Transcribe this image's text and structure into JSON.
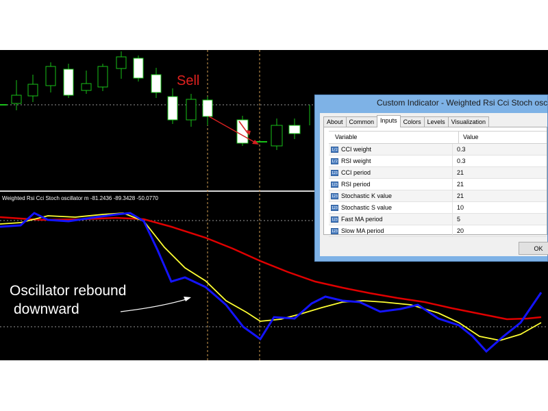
{
  "chart": {
    "sell_label": "Sell",
    "oscillator_header": "Weighted Rsi Cci Stoch oscillator m -81.2436 -89.3428 -50.0770",
    "annotation_line1": "Oscillator rebound",
    "annotation_line2": "downward",
    "colors": {
      "background": "#000000",
      "bull_candle": "#ffffff",
      "candle_outline": "#19c219",
      "blue_line": "#1414ff",
      "yellow_line": "#ffff33",
      "red_line": "#e00000",
      "sell_text": "#e0211f",
      "sell_arrow": "#d42020",
      "separator": "#d9d9d9",
      "vline": "#d4a055"
    }
  },
  "dialog": {
    "title": "Custom Indicator - Weighted Rsi Cci Stoch osc",
    "tabs": [
      "About",
      "Common",
      "Inputs",
      "Colors",
      "Levels",
      "Visualization"
    ],
    "active_tab": "Inputs",
    "columns": [
      "Variable",
      "Value"
    ],
    "rows": [
      {
        "icon": "1/2",
        "variable": "CCI weight",
        "value": "0.3"
      },
      {
        "icon": "1/2",
        "variable": "RSI weight",
        "value": "0.3"
      },
      {
        "icon": "123",
        "variable": "CCI period",
        "value": "21"
      },
      {
        "icon": "123",
        "variable": "RSI period",
        "value": "21"
      },
      {
        "icon": "123",
        "variable": "Stochastic K value",
        "value": "21"
      },
      {
        "icon": "123",
        "variable": "Stochastic S value",
        "value": "10"
      },
      {
        "icon": "123",
        "variable": "Fast MA period",
        "value": "5"
      },
      {
        "icon": "123",
        "variable": "Slow MA period",
        "value": "20"
      }
    ],
    "ok_label": "OK"
  }
}
